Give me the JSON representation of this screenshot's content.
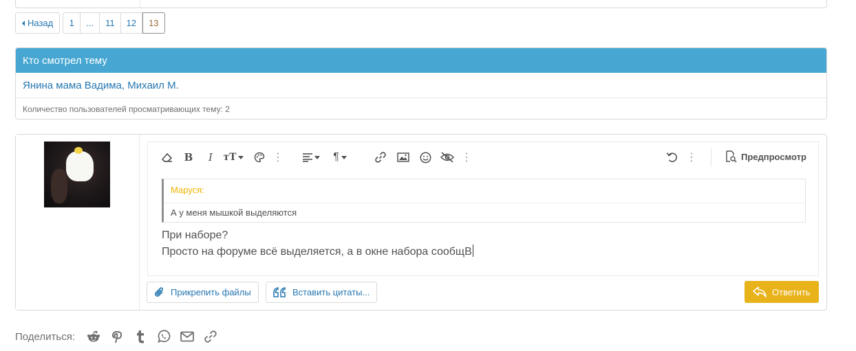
{
  "pagination": {
    "prev_label": "Назад",
    "pages": [
      "1",
      "...",
      "11",
      "12",
      "13"
    ],
    "current": "13"
  },
  "viewers": {
    "title": "Кто смотрел тему",
    "users": "Янина мама Вадима, Михаил М.",
    "count_text": "Количество пользователей просматривающих тему: 2"
  },
  "editor": {
    "preview_label": "Предпросмотр",
    "quote_author": "Маруся:",
    "quote_text": "А у меня мышкой выделяются",
    "body_line1": "При наборе?",
    "body_line2": "Просто на форуме всё выделяется, а в окне набора сообщВ"
  },
  "buttons": {
    "attach_label": "Прикрепить файлы",
    "insert_quotes_label": "Вставить цитаты...",
    "reply_label": "Ответить"
  },
  "share": {
    "label": "Поделиться:",
    "icons": [
      "reddit-icon",
      "pinterest-icon",
      "tumblr-icon",
      "whatsapp-icon",
      "email-icon",
      "link-icon"
    ]
  },
  "colors": {
    "accent": "#47a7d2",
    "link": "#2577b1",
    "reply_button": "#e8b21a",
    "quote_author": "#f0b400"
  }
}
